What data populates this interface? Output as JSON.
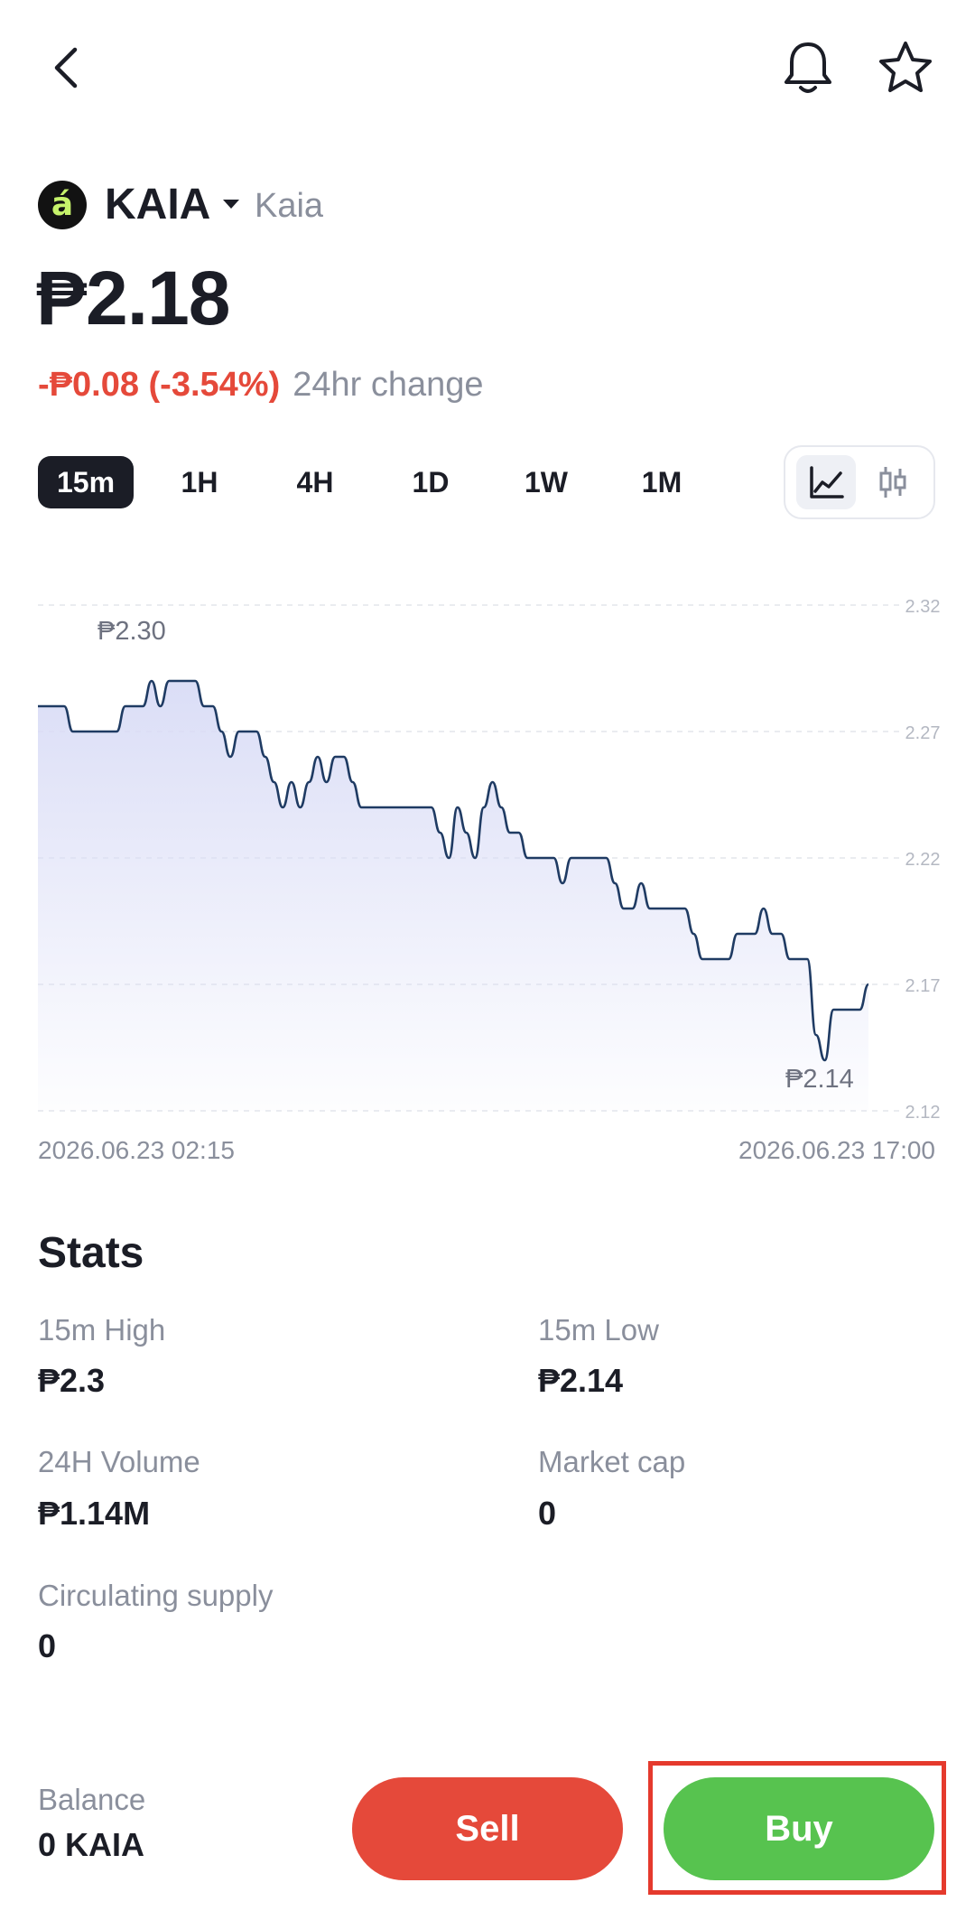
{
  "nav": {
    "back_icon": "chevron-left-icon",
    "bell_icon": "bell-icon",
    "star_icon": "star-icon"
  },
  "coin": {
    "logo_letter": "á",
    "logo_color": "#c6f36b",
    "symbol": "KAIA",
    "name": "Kaia",
    "price": "₱2.18",
    "change_value": "-₱0.08 (-3.54%)",
    "change_label": "24hr change",
    "change_color": "#e5493a"
  },
  "tabs": [
    {
      "label": "15m",
      "active": true
    },
    {
      "label": "1H",
      "active": false
    },
    {
      "label": "4H",
      "active": false
    },
    {
      "label": "1D",
      "active": false
    },
    {
      "label": "1W",
      "active": false
    },
    {
      "label": "1M",
      "active": false
    }
  ],
  "chart_types": [
    {
      "icon": "line-chart-icon",
      "active": true
    },
    {
      "icon": "candlestick-chart-icon",
      "active": false
    }
  ],
  "chart_data": {
    "type": "area",
    "y_ticks": [
      "2.32",
      "2.27",
      "2.22",
      "2.17",
      "2.12"
    ],
    "ylim": [
      2.12,
      2.32
    ],
    "high_label": "₱2.30",
    "low_label": "₱2.14",
    "start_date": "2026.06.23 02:15",
    "end_date": "2026.06.23 17:00",
    "line_color": "#1f3b63",
    "fill_color": "#d9dcf6",
    "grid": true,
    "series": [
      {
        "values": [
          2.28,
          2.28,
          2.28,
          2.28,
          2.27,
          2.27,
          2.27,
          2.27,
          2.27,
          2.27,
          2.28,
          2.28,
          2.28,
          2.29,
          2.28,
          2.29,
          2.29,
          2.29,
          2.29,
          2.28,
          2.28,
          2.27,
          2.26,
          2.27,
          2.27,
          2.27,
          2.26,
          2.25,
          2.24,
          2.25,
          2.24,
          2.25,
          2.26,
          2.25,
          2.26,
          2.26,
          2.25,
          2.24,
          2.24,
          2.24,
          2.24,
          2.24,
          2.24,
          2.24,
          2.24,
          2.24,
          2.23,
          2.22,
          2.24,
          2.23,
          2.22,
          2.24,
          2.25,
          2.24,
          2.23,
          2.23,
          2.22,
          2.22,
          2.22,
          2.22,
          2.21,
          2.22,
          2.22,
          2.22,
          2.22,
          2.22,
          2.21,
          2.2,
          2.2,
          2.21,
          2.2,
          2.2,
          2.2,
          2.2,
          2.2,
          2.19,
          2.18,
          2.18,
          2.18,
          2.18,
          2.19,
          2.19,
          2.19,
          2.2,
          2.19,
          2.19,
          2.18,
          2.18,
          2.18,
          2.15,
          2.14,
          2.16,
          2.16,
          2.16,
          2.16,
          2.17
        ]
      }
    ]
  },
  "stats": {
    "title": "Stats",
    "items": [
      {
        "label": "15m High",
        "value": "₱2.3"
      },
      {
        "label": "15m Low",
        "value": "₱2.14"
      },
      {
        "label": "24H Volume",
        "value": "₱1.14M"
      },
      {
        "label": "Market cap",
        "value": "0"
      },
      {
        "label": "Circulating supply",
        "value": "0"
      }
    ]
  },
  "footer": {
    "balance_label": "Balance",
    "balance_value": "0 KAIA",
    "sell_label": "Sell",
    "buy_label": "Buy",
    "sell_color": "#e5493a",
    "buy_color": "#57c34f"
  }
}
